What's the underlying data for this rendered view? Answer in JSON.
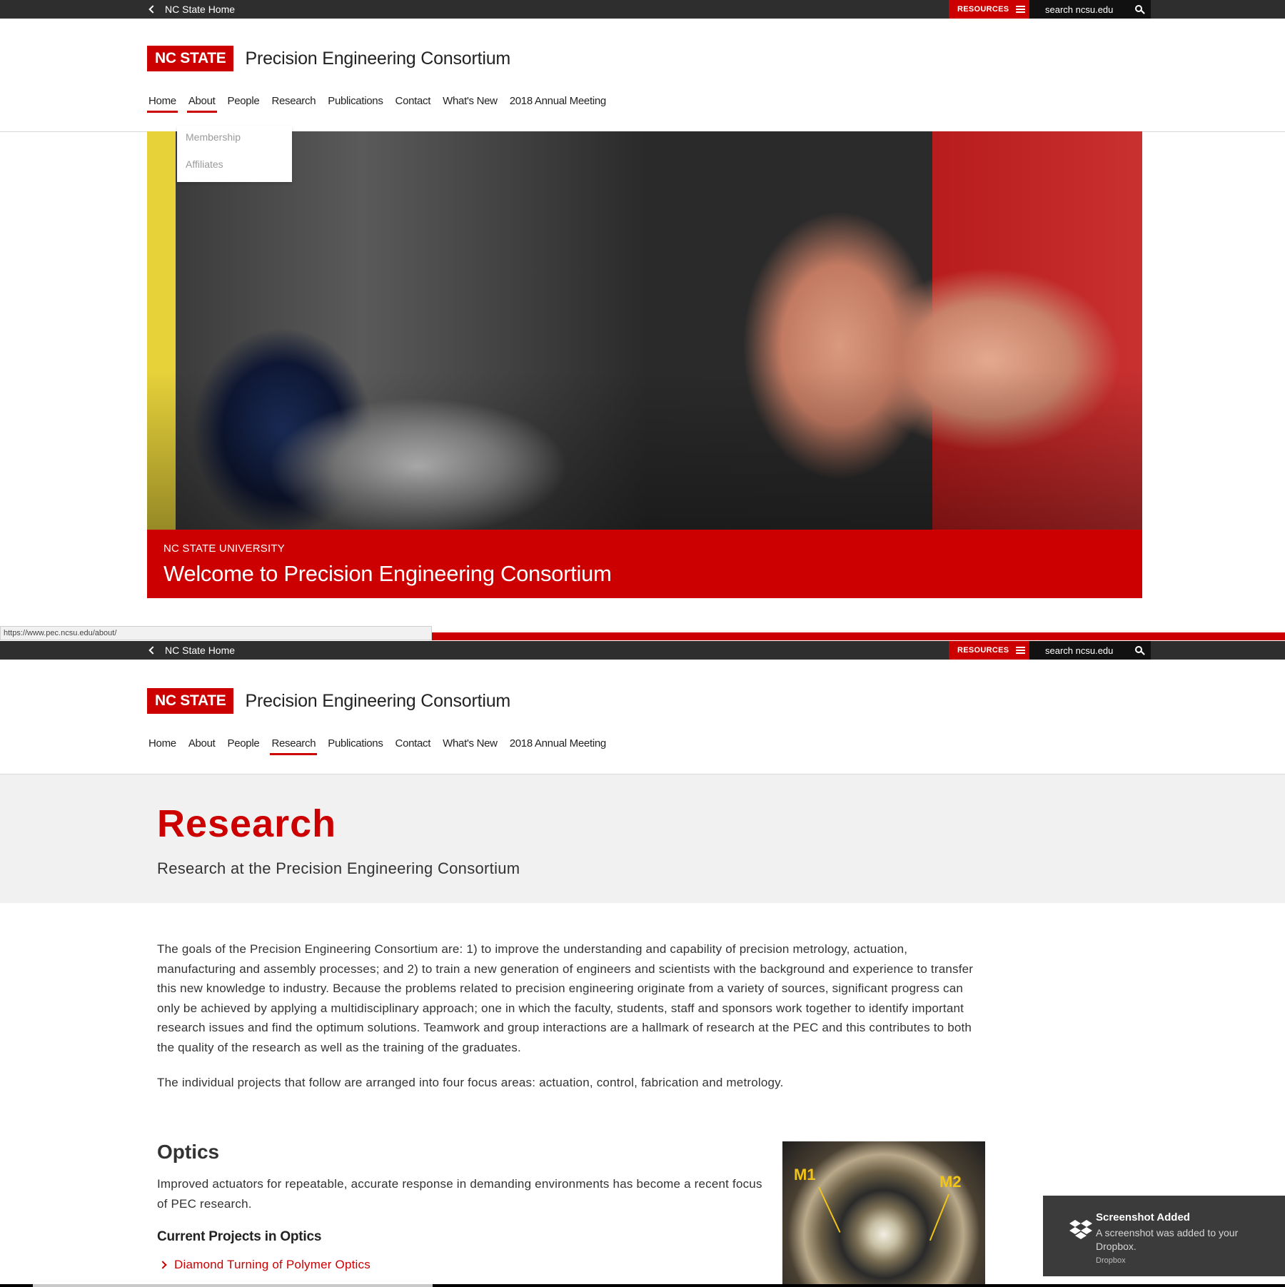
{
  "topbar": {
    "home_label": "NC State Home",
    "resources_label": "RESOURCES",
    "search_placeholder": "search ncsu.edu"
  },
  "brand": {
    "logo_text": "NC STATE",
    "site_title": "Precision Engineering Consortium",
    "accent_color": "#cc0000"
  },
  "nav": {
    "items": [
      "Home",
      "About",
      "People",
      "Research",
      "Publications",
      "Contact",
      "What's New",
      "2018 Annual Meeting"
    ]
  },
  "dropdown": {
    "items": [
      "Membership",
      "Affiliates"
    ]
  },
  "hero": {
    "kicker": "NC STATE UNIVERSITY",
    "headline": "Welcome to Precision Engineering Consortium"
  },
  "statusbar": {
    "url": "https://www.pec.ncsu.edu/about/"
  },
  "research": {
    "title": "Research",
    "subtitle": "Research at the Precision Engineering Consortium",
    "paragraph1": "The goals of the Precision Engineering Consortium are: 1) to improve the understanding and capability of precision metrology, actuation, manufacturing and assembly processes; and 2) to train a new generation of engineers and scientists with the background and experience to transfer this new knowledge to industry. Because the problems related to precision engineering originate from a variety of sources, significant progress can only be achieved by applying a multidisciplinary approach; one in which the faculty, students, staff and sponsors work together to identify important research issues and find the optimum solutions. Teamwork and group interactions are a hallmark of research at the PEC and this contributes to both the quality of the research as well as the training of the graduates.",
    "paragraph2": "The individual projects that follow are arranged into four focus areas: actuation, control, fabrication and metrology.",
    "optics_title": "Optics",
    "optics_desc": "Improved actuators for repeatable, accurate response in demanding environments has become a recent focus of PEC research.",
    "projects_title": "Current Projects in Optics",
    "project_link": "Diamond Turning of Polymer Optics",
    "image_labels": [
      "M1",
      "M2"
    ]
  },
  "toast": {
    "title": "Screenshot Added",
    "message": "A screenshot was added to your Dropbox.",
    "source": "Dropbox"
  }
}
